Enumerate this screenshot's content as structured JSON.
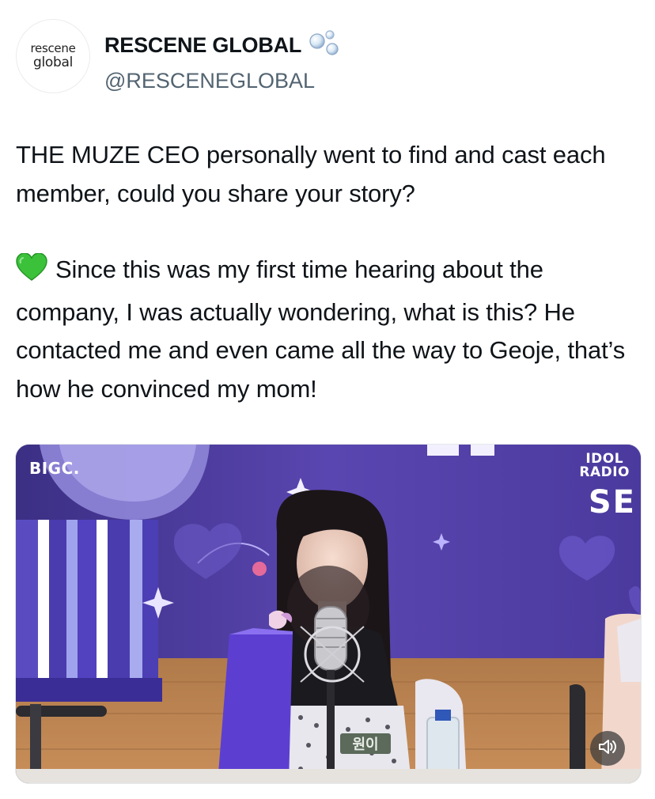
{
  "account": {
    "avatar_line1": "rescene",
    "avatar_line2": "global",
    "display_name": "RESCENE GLOBAL",
    "handle": "@RESCENEGLOBAL"
  },
  "tweet": {
    "paragraph1": "THE MUZE CEO personally went to find and cast each member, could you share your story?",
    "paragraph2": "Since this was my first time hearing about the company, I was actually wondering, what is this? He contacted me and even came all the way to Geoje, that’s how he convinced my mom!"
  },
  "media": {
    "logo_left": "BIGC.",
    "logo_right_line1": "IDOL",
    "logo_right_line2": "RADIO",
    "logo_right_big": "SE",
    "name_tag": "원이"
  },
  "icons": [
    "verified-bubbles-icon",
    "green-heart-icon",
    "speaker-icon"
  ],
  "colors": {
    "handle_gray": "#536471",
    "studio_purple": "#4a3a9a",
    "green_heart": "#3cc13b"
  }
}
